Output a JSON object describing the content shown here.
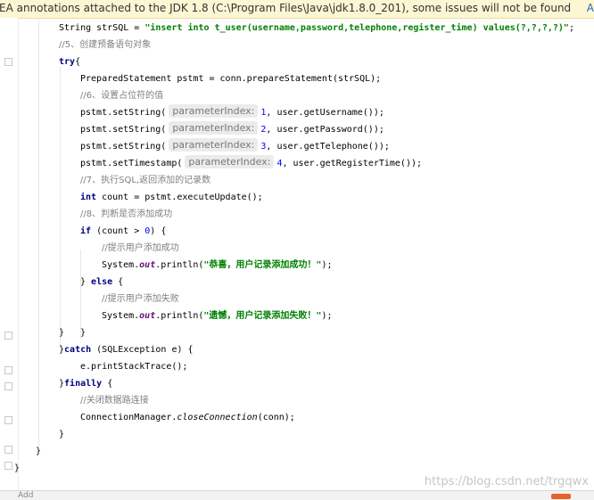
{
  "banner": {
    "message": "EA annotations attached to the JDK 1.8 (C:\\Program Files\\Java\\jdk1.8.0_201), some issues will not be found",
    "action": "A"
  },
  "code": {
    "line_sql_prefix": "String strSQL = ",
    "line_sql_string": "\"insert into t_user(username,password,telephone,register_time) values(?,?,?,?)\"",
    "line_sql_suffix": ";",
    "comment_5": "//5、创建预备语句对象",
    "kw_try": "try",
    "brace_open": "{",
    "line_pstmt": "PreparedStatement pstmt = conn.prepareStatement(strSQL);",
    "comment_6": "//6、设置占位符的值",
    "hint_label": "parameterIndex:",
    "set1_pre": "pstmt.setString(",
    "set1_num": "1",
    "set1_post": ", user.getUsername());",
    "set2_pre": "pstmt.setString(",
    "set2_num": "2",
    "set2_post": ", user.getPassword());",
    "set3_pre": "pstmt.setString(",
    "set3_num": "3",
    "set3_post": ", user.getTelephone());",
    "set4_pre": "pstmt.setTimestamp(",
    "set4_num": "4",
    "set4_post": ", user.getRegisterTime());",
    "comment_7": "//7、执行SQL,返回添加的记录数",
    "kw_int": "int",
    "count_line": " count = pstmt.executeUpdate();",
    "comment_8": "//8、判断是否添加成功",
    "kw_if": "if",
    "if_cond_pre": " (count > ",
    "if_zero": "0",
    "if_cond_post": ") {",
    "comment_success": "//提示用户添加成功",
    "println_pre": "System.",
    "println_out": "out",
    "println_mid": ".println(",
    "msg_success": "\"恭喜，用户记录添加成功！\"",
    "println_end": ");",
    "else_pre": "} ",
    "kw_else": "else",
    "else_post": " {",
    "comment_fail": "//提示用户添加失败",
    "msg_fail": "\"遗憾，用户记录添加失败！\"",
    "brace_close": "}",
    "catch_pre": "}",
    "kw_catch": "catch",
    "catch_post": " (SQLException e) {",
    "print_stack": "e.printStackTrace();",
    "finally_pre": "}",
    "kw_finally": "finally",
    "finally_post": " {",
    "comment_close": "//关闭数据路连接",
    "close_pre": "ConnectionManager.",
    "close_method": "closeConnection",
    "close_post": "(conn);"
  },
  "watermark": "https://blog.csdn.net/trgqwx",
  "bottom_tab": "Add "
}
